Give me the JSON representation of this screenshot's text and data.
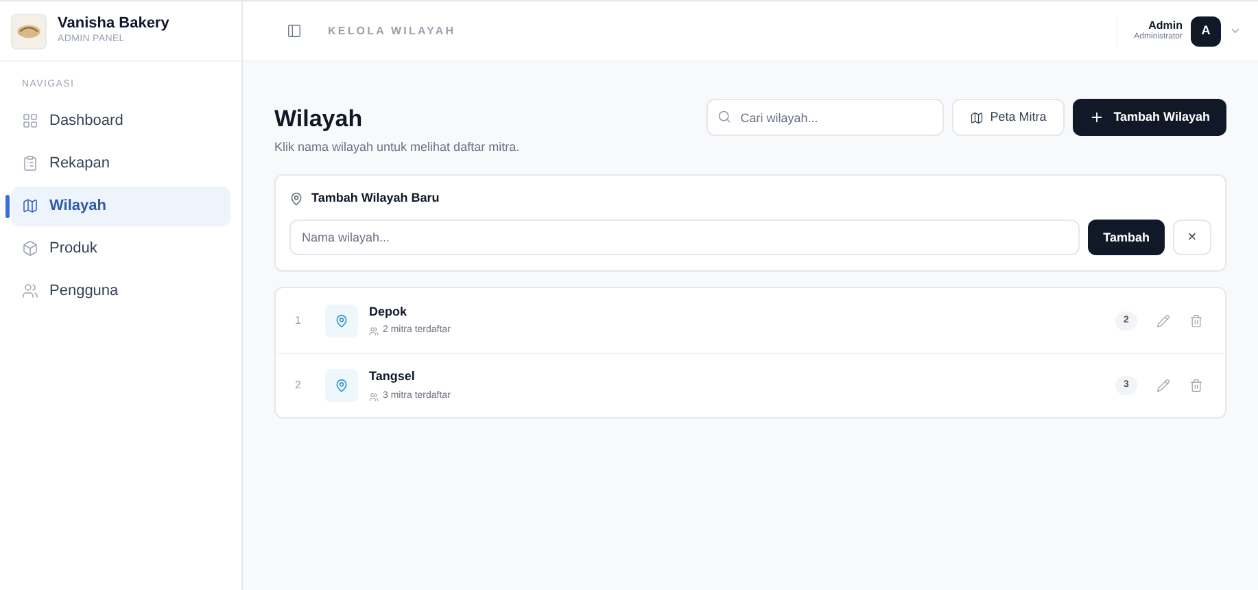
{
  "brand": {
    "name": "Vanisha Bakery",
    "subtitle": "ADMIN PANEL"
  },
  "sidebar": {
    "heading": "NAVIGASI",
    "items": [
      {
        "label": "Dashboard",
        "selected": false
      },
      {
        "label": "Rekapan",
        "selected": false
      },
      {
        "label": "Wilayah",
        "selected": true
      },
      {
        "label": "Produk",
        "selected": false
      },
      {
        "label": "Pengguna",
        "selected": false
      }
    ]
  },
  "topbar": {
    "title": "KELOLA WILAYAH",
    "user": {
      "name": "Admin",
      "role": "Administrator",
      "initial": "A"
    }
  },
  "page": {
    "title": "Wilayah",
    "subtitle": "Klik nama wilayah untuk melihat daftar mitra.",
    "search": {
      "placeholder": "Cari wilayah..."
    },
    "map_button": "Peta Mitra",
    "add_button": "Tambah Wilayah"
  },
  "add_form": {
    "title": "Tambah Wilayah Baru",
    "input": {
      "placeholder": "Nama wilayah..."
    },
    "submit": "Tambah",
    "close": "×"
  },
  "regions": [
    {
      "number": "1",
      "name": "Depok",
      "mitra": "2 mitra terdaftar",
      "count": "2"
    },
    {
      "number": "2",
      "name": "Tangsel",
      "mitra": "3 mitra terdaftar",
      "count": "3"
    }
  ]
}
